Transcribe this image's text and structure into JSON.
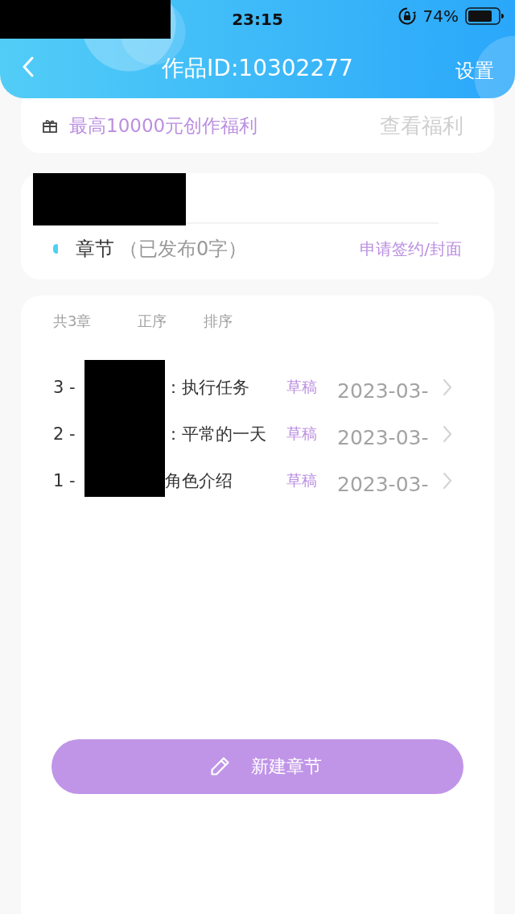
{
  "status_bar": {
    "time": "23:15",
    "battery": "74%"
  },
  "nav_bar": {
    "title": "作品ID:10302277",
    "action": "设置"
  },
  "benefit_banner": {
    "text": "最高10000元创作福利",
    "link": "查看福利"
  },
  "book_card": {
    "section": "章节",
    "published": "（已发布0字）",
    "link": "申请签约/封面"
  },
  "chapter_list": {
    "count": "共3章",
    "order": "正序",
    "sort": "排序",
    "chapters": [
      {
        "number": "3 -",
        "title": "：执行任务",
        "status": "草稿",
        "date": "2023-03-"
      },
      {
        "number": "2 -",
        "title": "：平常的一天",
        "status": "草稿",
        "date": "2023-03-"
      },
      {
        "number": "1 -",
        "title": "角色介绍",
        "status": "草稿",
        "date": "2023-03-"
      }
    ]
  },
  "new_chapter_button": {
    "label": "新建章节"
  }
}
